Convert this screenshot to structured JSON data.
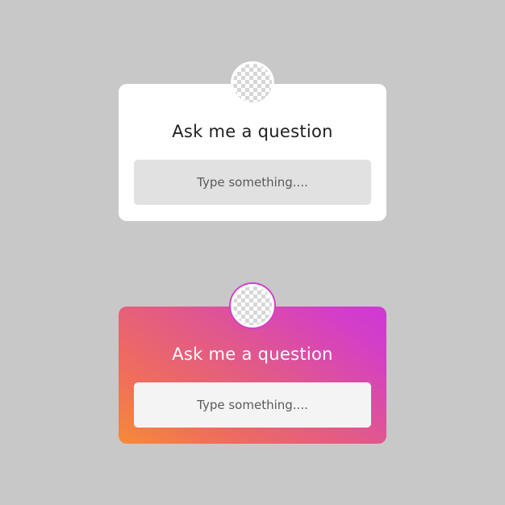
{
  "stickers": [
    {
      "title": "Ask me a question",
      "placeholder": "Type something....",
      "style": "white"
    },
    {
      "title": "Ask me a question",
      "placeholder": "Type something....",
      "style": "gradient"
    }
  ],
  "colors": {
    "background": "#c8c8c8",
    "card_white": "#ffffff",
    "field_grey": "#e1e1e1",
    "gradient_start": "#f58a38",
    "gradient_mid": "#e1588c",
    "gradient_end": "#cf38d6"
  }
}
